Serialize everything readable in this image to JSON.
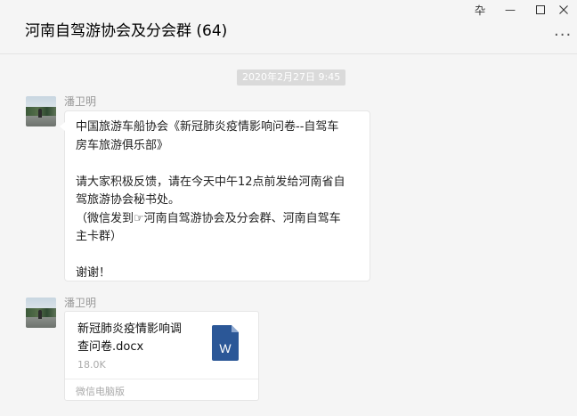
{
  "header": {
    "title": "河南自驾游协会及分会群 (64)",
    "pin_glyph": "卆",
    "min_glyph": "—",
    "max_glyph": "☐",
    "close_glyph": "✕",
    "more_glyph": "..."
  },
  "timestamp": "2020年2月27日  9:45",
  "messages": [
    {
      "sender": "潘卫明",
      "avatar_icon": "landscape-photo-avatar",
      "lines": [
        "中国旅游车船协会《新冠肺炎疫情影响问卷--自驾车",
        "房车旅游俱乐部》",
        "",
        "请大家积极反馈，请在今天中午12点前发给河南省自",
        "驾旅游协会秘书处。",
        "（微信发到☞河南自驾游协会及分会群、河南自驾车",
        "主卡群）",
        "",
        "谢谢！"
      ]
    },
    {
      "sender": "潘卫明",
      "avatar_icon": "landscape-photo-avatar",
      "file": {
        "name_line1": "新冠肺炎疫情影响调",
        "name_line2": "查问卷.docx",
        "size": "18.0K",
        "source": "微信电脑版",
        "icon": "word-document-icon",
        "icon_letter": "W",
        "icon_color": "#2b5797"
      }
    }
  ]
}
